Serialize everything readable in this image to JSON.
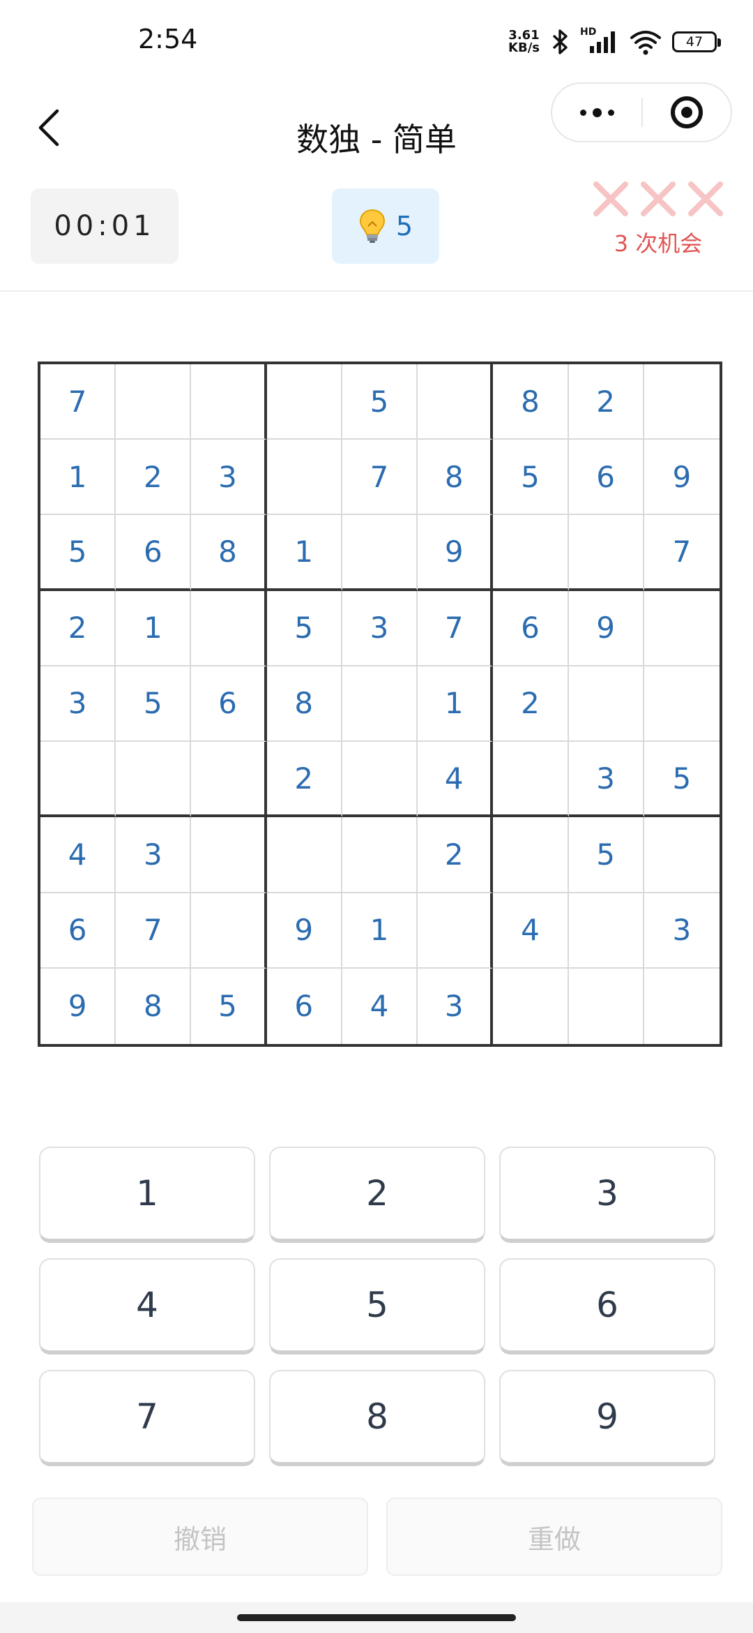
{
  "status_bar": {
    "time": "2:54",
    "speed_value": "3.61",
    "speed_unit": "KB/s",
    "network_label": "HD",
    "battery": "47"
  },
  "nav": {
    "title": "数独 - 简单"
  },
  "info": {
    "timer": "00:01",
    "hint_count": "5",
    "chances_text": "3 次机会",
    "mistake_color": "#f6c4c4"
  },
  "grid": {
    "rows": [
      [
        "7",
        "",
        "",
        "",
        "5",
        "",
        "8",
        "2",
        ""
      ],
      [
        "1",
        "2",
        "3",
        "",
        "7",
        "8",
        "5",
        "6",
        "9"
      ],
      [
        "5",
        "6",
        "8",
        "1",
        "",
        "9",
        "",
        "",
        "7"
      ],
      [
        "2",
        "1",
        "",
        "5",
        "3",
        "7",
        "6",
        "9",
        ""
      ],
      [
        "3",
        "5",
        "6",
        "8",
        "",
        "1",
        "2",
        "",
        ""
      ],
      [
        "",
        "",
        "",
        "2",
        "",
        "4",
        "",
        "3",
        "5"
      ],
      [
        "4",
        "3",
        "",
        "",
        "",
        "2",
        "",
        "5",
        ""
      ],
      [
        "6",
        "7",
        "",
        "9",
        "1",
        "",
        "4",
        "",
        "3"
      ],
      [
        "9",
        "8",
        "5",
        "6",
        "4",
        "3",
        "",
        "",
        ""
      ]
    ]
  },
  "numpad": {
    "keys": [
      "1",
      "2",
      "3",
      "4",
      "5",
      "6",
      "7",
      "8",
      "9"
    ]
  },
  "actions": {
    "undo": "撤销",
    "redo": "重做"
  },
  "colors": {
    "digit": "#2b6cb0",
    "accent_hint_bg": "#e4f2fd",
    "chances_text": "#e05555"
  }
}
